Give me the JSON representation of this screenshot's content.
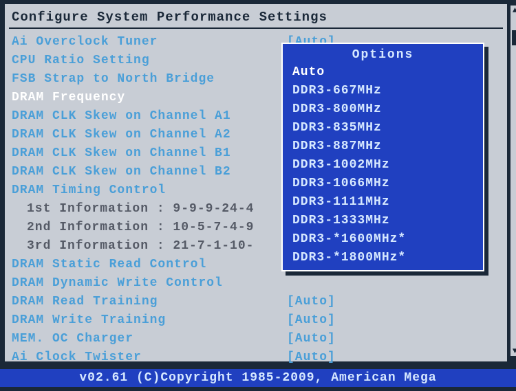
{
  "title": "Configure System Performance Settings",
  "settings": [
    {
      "label": "Ai Overclock Tuner",
      "value": "[Auto]",
      "selected": false,
      "indent": false
    },
    {
      "label": "CPU Ratio Setting",
      "value": "",
      "selected": false,
      "indent": false
    },
    {
      "label": "FSB Strap to North Bridge",
      "value": "",
      "selected": false,
      "indent": false
    },
    {
      "label": "DRAM Frequency",
      "value": "",
      "selected": true,
      "indent": false
    },
    {
      "label": "DRAM CLK Skew on Channel A1",
      "value": "",
      "selected": false,
      "indent": false
    },
    {
      "label": "DRAM CLK Skew on Channel A2",
      "value": "",
      "selected": false,
      "indent": false
    },
    {
      "label": "DRAM CLK Skew on Channel B1",
      "value": "",
      "selected": false,
      "indent": false
    },
    {
      "label": "DRAM CLK Skew on Channel B2",
      "value": "",
      "selected": false,
      "indent": false
    },
    {
      "label": "DRAM Timing Control",
      "value": "",
      "selected": false,
      "indent": false
    },
    {
      "label": "1st Information : 9-9-9-24-4",
      "value": "",
      "selected": false,
      "indent": true
    },
    {
      "label": "2nd Information : 10-5-7-4-9",
      "value": "",
      "selected": false,
      "indent": true
    },
    {
      "label": "3rd Information : 21-7-1-10-",
      "value": "",
      "selected": false,
      "indent": true
    },
    {
      "label": "DRAM Static Read Control",
      "value": "",
      "selected": false,
      "indent": false
    },
    {
      "label": "DRAM Dynamic Write Control",
      "value": "",
      "selected": false,
      "indent": false
    },
    {
      "label": "DRAM Read Training",
      "value": "[Auto]",
      "selected": false,
      "indent": false
    },
    {
      "label": "DRAM Write Training",
      "value": "[Auto]",
      "selected": false,
      "indent": false
    },
    {
      "label": "MEM. OC Charger",
      "value": "[Auto]",
      "selected": false,
      "indent": false
    },
    {
      "label": "Ai Clock Twister",
      "value": "[Auto]",
      "selected": false,
      "indent": false
    }
  ],
  "popup": {
    "title": "Options",
    "selected_index": 0,
    "items": [
      "Auto",
      "DDR3-667MHz",
      "DDR3-800MHz",
      "DDR3-835MHz",
      "DDR3-887MHz",
      "DDR3-1002MHz",
      "DDR3-1066MHz",
      "DDR3-1111MHz",
      "DDR3-1333MHz",
      "DDR3-*1600MHz*",
      "DDR3-*1800MHz*"
    ]
  },
  "footer": "v02.61 (C)Copyright 1985-2009, American Mega"
}
